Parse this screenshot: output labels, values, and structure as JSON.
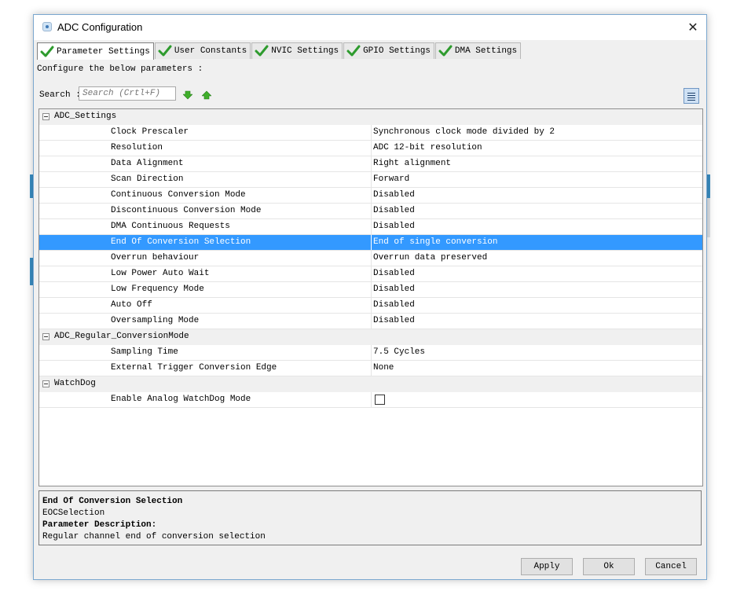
{
  "window": {
    "title": "ADC Configuration"
  },
  "tabs": [
    {
      "label": "Parameter Settings",
      "active": true
    },
    {
      "label": "User Constants",
      "active": false
    },
    {
      "label": "NVIC Settings",
      "active": false
    },
    {
      "label": "GPIO Settings",
      "active": false
    },
    {
      "label": "DMA Settings",
      "active": false
    }
  ],
  "configure_text": "Configure the below parameters :",
  "search": {
    "label": "Search :",
    "placeholder": "Search (Crtl+F)"
  },
  "groups": {
    "adc_settings": {
      "name": "ADC_Settings",
      "rows": [
        {
          "name": "Clock Prescaler",
          "value": "Synchronous clock mode divided by 2"
        },
        {
          "name": "Resolution",
          "value": "ADC 12-bit resolution"
        },
        {
          "name": "Data Alignment",
          "value": "Right alignment"
        },
        {
          "name": "Scan Direction",
          "value": "Forward"
        },
        {
          "name": "Continuous Conversion Mode",
          "value": "Disabled"
        },
        {
          "name": "Discontinuous Conversion Mode",
          "value": "Disabled"
        },
        {
          "name": "DMA Continuous Requests",
          "value": "Disabled"
        },
        {
          "name": "End Of Conversion Selection",
          "value": "End of single conversion"
        },
        {
          "name": "Overrun behaviour",
          "value": "Overrun data preserved"
        },
        {
          "name": "Low Power Auto Wait",
          "value": "Disabled"
        },
        {
          "name": "Low Frequency Mode",
          "value": "Disabled"
        },
        {
          "name": "Auto Off",
          "value": "Disabled"
        },
        {
          "name": "Oversampling Mode",
          "value": "Disabled"
        }
      ]
    },
    "regular": {
      "name": "ADC_Regular_ConversionMode",
      "rows": [
        {
          "name": "Sampling Time",
          "value": "7.5 Cycles"
        },
        {
          "name": "External Trigger Conversion Edge",
          "value": "None"
        }
      ]
    },
    "watchdog": {
      "name": "WatchDog",
      "rows": [
        {
          "name": "Enable Analog WatchDog Mode",
          "checked": false
        }
      ]
    }
  },
  "description": {
    "title": "End Of Conversion Selection",
    "id": "EOCSelection",
    "param_label": "Parameter Description:",
    "text": "Regular channel end of conversion selection"
  },
  "buttons": {
    "apply": "Apply",
    "ok": "Ok",
    "cancel": "Cancel"
  },
  "colors": {
    "selection": "#3399ff",
    "check_green": "#2e9b2e",
    "accent_border": "#7aa7cf"
  }
}
